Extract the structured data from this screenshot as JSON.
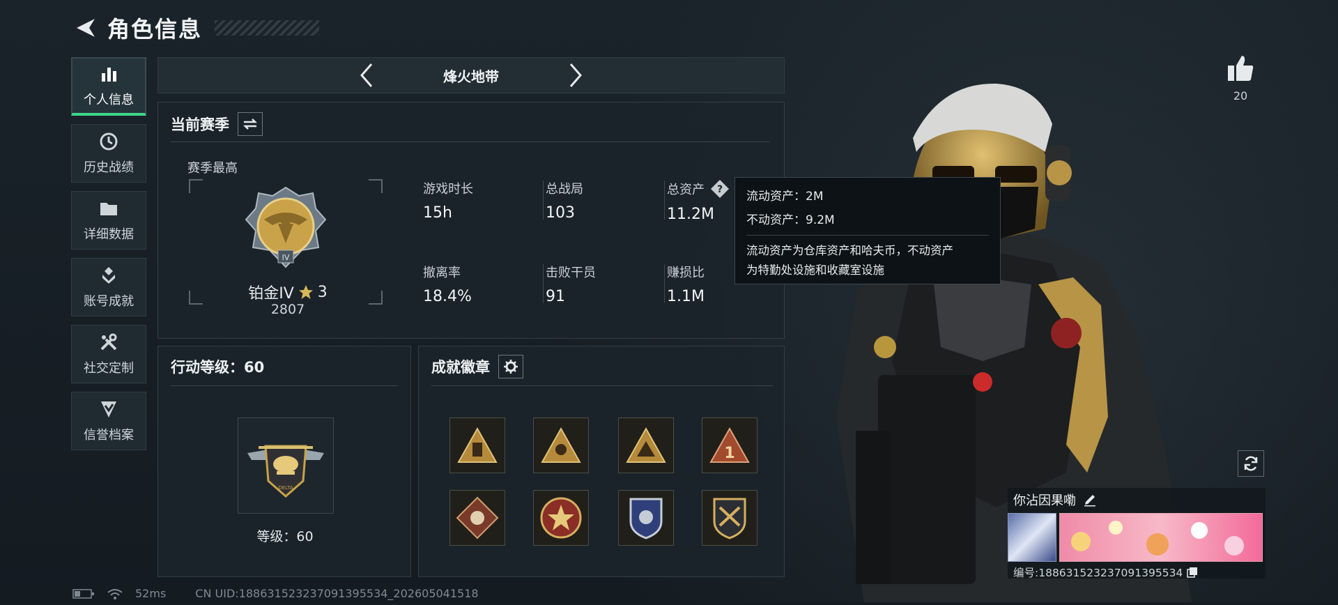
{
  "header": {
    "title": "角色信息"
  },
  "sidenav": [
    {
      "label": "个人信息",
      "icon": "bar-chart-icon"
    },
    {
      "label": "历史战绩",
      "icon": "history-icon"
    },
    {
      "label": "详细数据",
      "icon": "folder-icon"
    },
    {
      "label": "账号成就",
      "icon": "achievement-icon"
    },
    {
      "label": "社交定制",
      "icon": "tools-icon"
    },
    {
      "label": "信誉档案",
      "icon": "shield-check-icon"
    }
  ],
  "mode": {
    "title": "烽火地带"
  },
  "season": {
    "header": "当前赛季",
    "best_label": "赛季最高",
    "rank_name": "铂金IV",
    "rank_stars": "3",
    "rank_score": "2807",
    "stats": [
      {
        "label": "游戏时长",
        "value": "15h"
      },
      {
        "label": "总战局",
        "value": "103"
      },
      {
        "label": "总资产",
        "value": "11.2M"
      },
      {
        "label": "撤离率",
        "value": "18.4%"
      },
      {
        "label": "击败干员",
        "value": "91"
      },
      {
        "label": "赚损比",
        "value": "1.1M"
      }
    ]
  },
  "tooltip": {
    "liquid": "流动资产：2M",
    "fixed": "不动资产：9.2M",
    "note_line1": "流动资产为仓库资产和哈夫币，不动资产",
    "note_line2": "为特勤处设施和收藏室设施"
  },
  "action_level": {
    "header": "行动等级：60",
    "level_label": "等级：60"
  },
  "achievements": {
    "header": "成就徽章"
  },
  "likes": {
    "count": "20"
  },
  "player": {
    "name": "你沾因果嘞",
    "id_line": "编号:18863152323709139553​4"
  },
  "status": {
    "ping": "52ms",
    "uid": "CN UID:18863152323709139553​4_202605041518"
  },
  "colors": {
    "accent_green": "#3fd68a",
    "gold": "#c9a24a"
  }
}
